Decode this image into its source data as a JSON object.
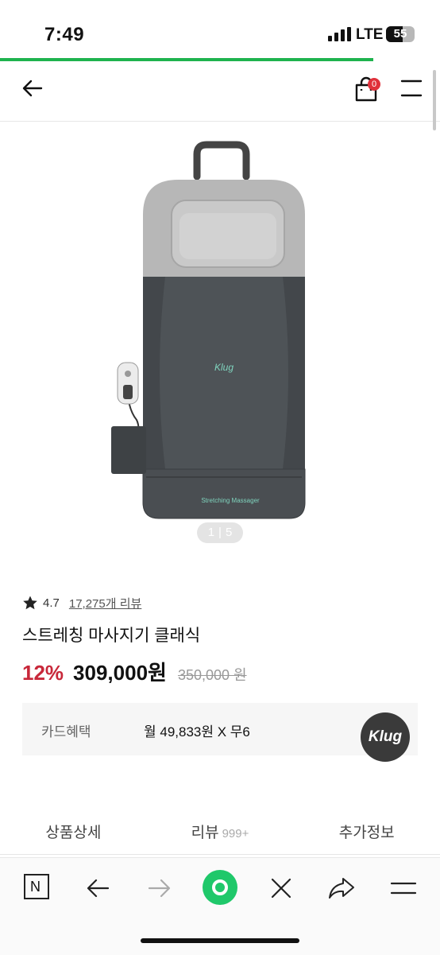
{
  "status_bar": {
    "time": "7:49",
    "network": "LTE",
    "battery": "55"
  },
  "header": {
    "cart_count": "0",
    "back_icon": "arrow-left-icon",
    "cart_icon": "shopping-bag-icon",
    "menu_icon": "hamburger-menu-icon"
  },
  "gallery": {
    "current": "1",
    "separator": "|",
    "total": "5",
    "device_brand": "Klug",
    "device_caption": "Stretching Massager"
  },
  "product": {
    "rating": "4.7",
    "reviews_link": "17,275개 리뷰",
    "title": "스트레칭 마사지기 클래식",
    "discount": "12%",
    "price": "309,000원",
    "original_price": "350,000 원"
  },
  "card_benefit": {
    "label": "카드혜택",
    "value": "월 49,833원 X 무6"
  },
  "brand_logo": "Klug",
  "tabs": [
    {
      "label": "상품상세",
      "count": ""
    },
    {
      "label": "리뷰",
      "count": "999+"
    },
    {
      "label": "추가정보",
      "count": ""
    }
  ],
  "bottom_nav": {
    "n_label": "N",
    "items": [
      "naver-n-icon",
      "back-arrow-icon",
      "forward-arrow-icon",
      "green-home-icon",
      "close-icon",
      "share-icon",
      "menu-icon"
    ]
  },
  "colors": {
    "accent_green": "#1fb34e",
    "discount_red": "#c8283a",
    "badge_red": "#e0313b"
  }
}
